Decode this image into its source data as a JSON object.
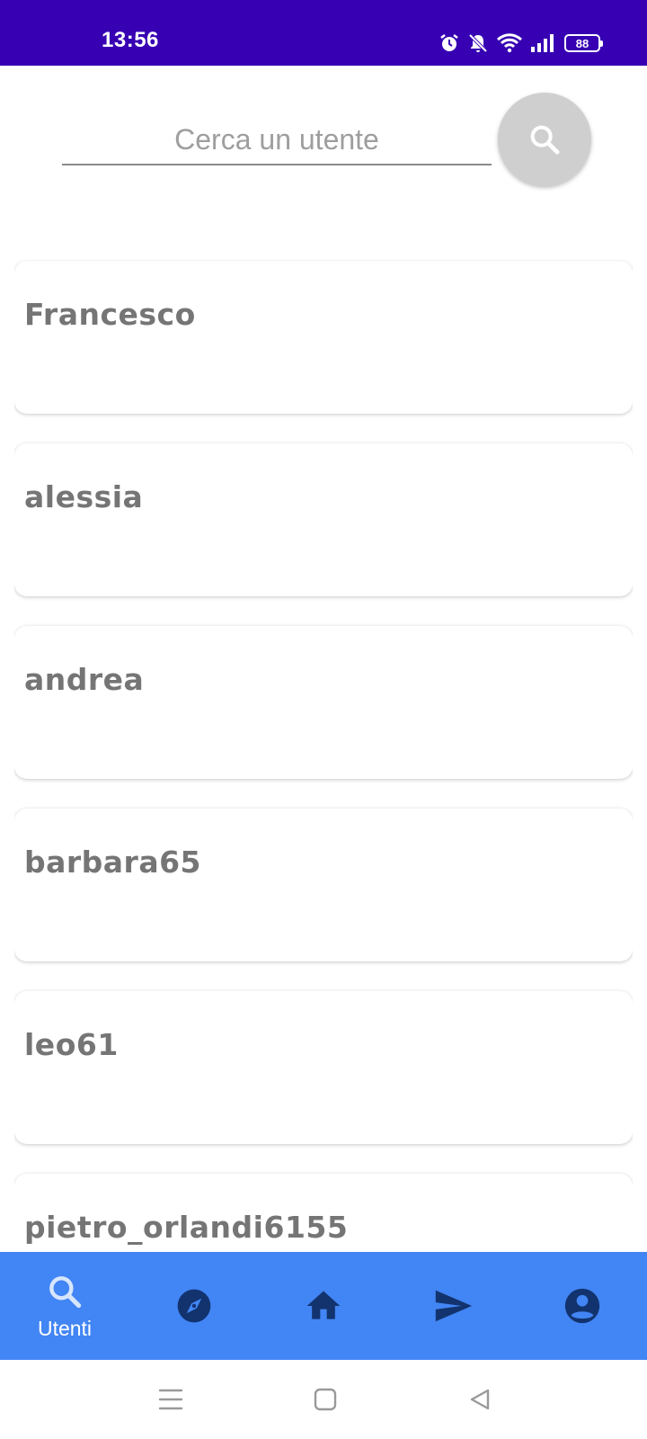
{
  "status_bar": {
    "time": "13:56",
    "battery": "88",
    "background_color": "#3700b3"
  },
  "search": {
    "placeholder": "Cerca un utente",
    "value": ""
  },
  "users": [
    {
      "name": "Francesco"
    },
    {
      "name": "alessia"
    },
    {
      "name": "andrea"
    },
    {
      "name": "barbara65"
    },
    {
      "name": "leo61"
    },
    {
      "name": "pietro_orlandi6155"
    }
  ],
  "bottom_nav": {
    "background_color": "#4285f4",
    "active_label": "Utenti",
    "items": [
      {
        "icon": "search-icon",
        "label": "Utenti",
        "active": true
      },
      {
        "icon": "compass-icon",
        "active": false
      },
      {
        "icon": "home-icon",
        "active": false
      },
      {
        "icon": "send-icon",
        "active": false
      },
      {
        "icon": "account-circle-icon",
        "active": false
      }
    ]
  }
}
